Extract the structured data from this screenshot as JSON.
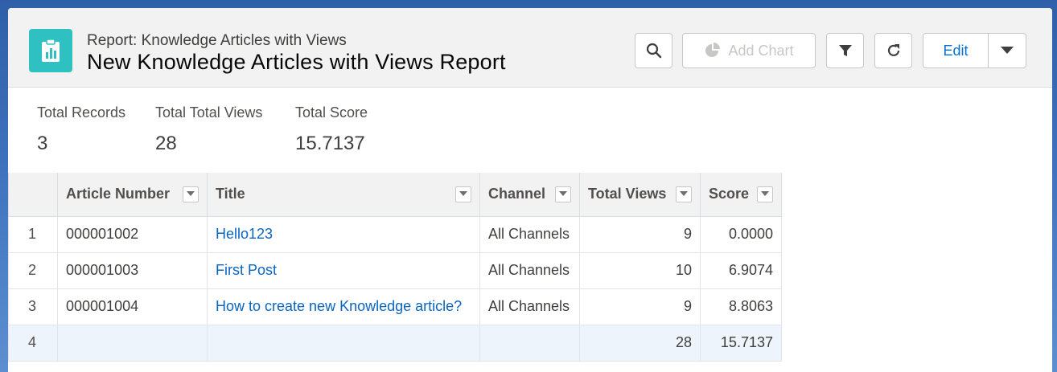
{
  "header": {
    "report_type": "Report: Knowledge Articles with Views",
    "report_name": "New Knowledge Articles with Views Report",
    "buttons": {
      "add_chart": "Add Chart",
      "edit": "Edit"
    }
  },
  "summary": [
    {
      "label": "Total Records",
      "value": "3"
    },
    {
      "label": "Total Total Views",
      "value": "28"
    },
    {
      "label": "Total Score",
      "value": "15.7137"
    }
  ],
  "table": {
    "columns": [
      "Article Number",
      "Title",
      "Channel",
      "Total Views",
      "Score"
    ],
    "rows": [
      {
        "n": "1",
        "article": "000001002",
        "title": "Hello123",
        "channel": "All Channels",
        "views": "9",
        "score": "0.0000"
      },
      {
        "n": "2",
        "article": "000001003",
        "title": "First Post",
        "channel": "All Channels",
        "views": "10",
        "score": "6.9074"
      },
      {
        "n": "3",
        "article": "000001004",
        "title": "How to create new Knowledge article?",
        "channel": "All Channels",
        "views": "9",
        "score": "8.8063"
      }
    ],
    "total_row": {
      "n": "4",
      "views": "28",
      "score": "15.7137"
    }
  },
  "colors": {
    "accent": "#0070d2",
    "icon_bg": "#2fc1c1",
    "link": "#0a65c2"
  },
  "icons": [
    "report-icon",
    "search-icon",
    "chart-icon",
    "filter-icon",
    "refresh-icon",
    "chevron-down-icon"
  ]
}
